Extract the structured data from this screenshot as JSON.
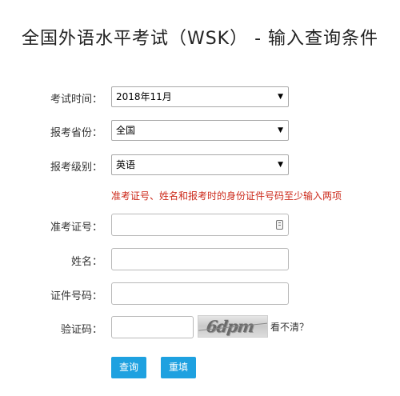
{
  "title": "全国外语水平考试（WSK） - 输入查询条件",
  "form": {
    "exam_time": {
      "label": "考试时间：",
      "value": "2018年11月"
    },
    "province": {
      "label": "报考省份：",
      "value": "全国"
    },
    "level": {
      "label": "报考级别：",
      "value": "英语"
    },
    "hint": "准考证号、姓名和报考时的身份证件号码至少输入两项",
    "ticket_no": {
      "label": "准考证号：",
      "value": ""
    },
    "name": {
      "label": "姓名：",
      "value": ""
    },
    "id_no": {
      "label": "证件号码：",
      "value": ""
    },
    "captcha": {
      "label": "验证码：",
      "value": "",
      "image_text": "6dpm",
      "refresh_text": "看不清？"
    }
  },
  "buttons": {
    "query": "查询",
    "reset": "重填"
  },
  "colors": {
    "button_bg": "#1ea1e0",
    "hint": "#cc2a1b"
  },
  "icons": {
    "dropdown": "triangle-down",
    "id_card": "id-card-icon"
  }
}
